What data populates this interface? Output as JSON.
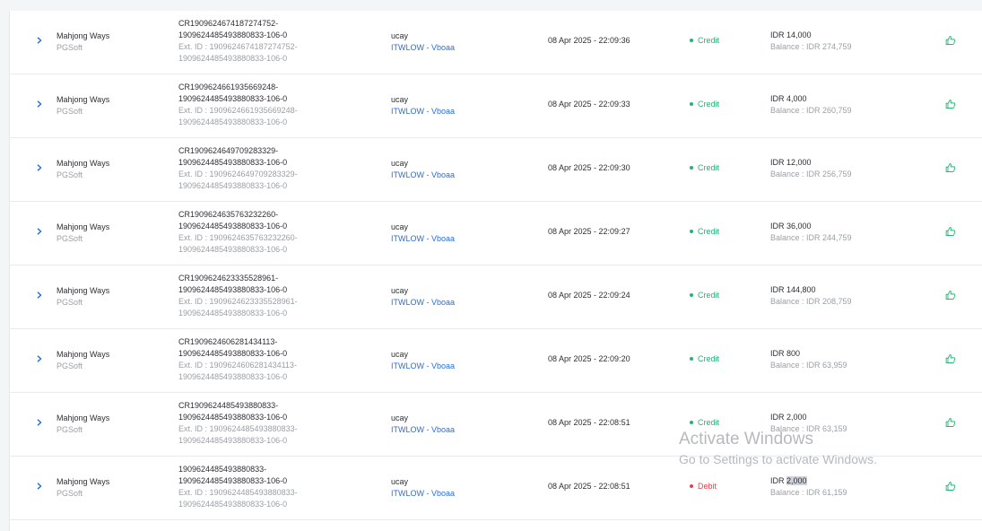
{
  "rows": [
    {
      "game": "Mahjong Ways",
      "provider": "PGSoft",
      "txn_line1": "CR1909624674187274752-",
      "txn_line2": "1909624485493880833-106-0",
      "ext_line1": "Ext. ID : 1909624674187274752-",
      "ext_line2": "1909624485493880833-106-0",
      "user": "ucay",
      "agent": "ITWLOW - Vboaa",
      "datetime": "08 Apr 2025 - 22:09:36",
      "type": "Credit",
      "amount_prefix": "IDR ",
      "amount_value": "14,000",
      "balance": "Balance : IDR 274,759"
    },
    {
      "game": "Mahjong Ways",
      "provider": "PGSoft",
      "txn_line1": "CR1909624661935669248-",
      "txn_line2": "1909624485493880833-106-0",
      "ext_line1": "Ext. ID : 1909624661935669248-",
      "ext_line2": "1909624485493880833-106-0",
      "user": "ucay",
      "agent": "ITWLOW - Vboaa",
      "datetime": "08 Apr 2025 - 22:09:33",
      "type": "Credit",
      "amount_prefix": "IDR ",
      "amount_value": "4,000",
      "balance": "Balance : IDR 260,759"
    },
    {
      "game": "Mahjong Ways",
      "provider": "PGSoft",
      "txn_line1": "CR1909624649709283329-",
      "txn_line2": "1909624485493880833-106-0",
      "ext_line1": "Ext. ID : 1909624649709283329-",
      "ext_line2": "1909624485493880833-106-0",
      "user": "ucay",
      "agent": "ITWLOW - Vboaa",
      "datetime": "08 Apr 2025 - 22:09:30",
      "type": "Credit",
      "amount_prefix": "IDR ",
      "amount_value": "12,000",
      "balance": "Balance : IDR 256,759"
    },
    {
      "game": "Mahjong Ways",
      "provider": "PGSoft",
      "txn_line1": "CR1909624635763232260-",
      "txn_line2": "1909624485493880833-106-0",
      "ext_line1": "Ext. ID : 1909624635763232260-",
      "ext_line2": "1909624485493880833-106-0",
      "user": "ucay",
      "agent": "ITWLOW - Vboaa",
      "datetime": "08 Apr 2025 - 22:09:27",
      "type": "Credit",
      "amount_prefix": "IDR ",
      "amount_value": "36,000",
      "balance": "Balance : IDR 244,759"
    },
    {
      "game": "Mahjong Ways",
      "provider": "PGSoft",
      "txn_line1": "CR1909624623335528961-",
      "txn_line2": "1909624485493880833-106-0",
      "ext_line1": "Ext. ID : 1909624623335528961-",
      "ext_line2": "1909624485493880833-106-0",
      "user": "ucay",
      "agent": "ITWLOW - Vboaa",
      "datetime": "08 Apr 2025 - 22:09:24",
      "type": "Credit",
      "amount_prefix": "IDR ",
      "amount_value": "144,800",
      "balance": "Balance : IDR 208,759"
    },
    {
      "game": "Mahjong Ways",
      "provider": "PGSoft",
      "txn_line1": "CR1909624606281434113-",
      "txn_line2": "1909624485493880833-106-0",
      "ext_line1": "Ext. ID : 1909624606281434113-",
      "ext_line2": "1909624485493880833-106-0",
      "user": "ucay",
      "agent": "ITWLOW - Vboaa",
      "datetime": "08 Apr 2025 - 22:09:20",
      "type": "Credit",
      "amount_prefix": "IDR ",
      "amount_value": "800",
      "balance": "Balance : IDR 63,959"
    },
    {
      "game": "Mahjong Ways",
      "provider": "PGSoft",
      "txn_line1": "CR1909624485493880833-",
      "txn_line2": "1909624485493880833-106-0",
      "ext_line1": "Ext. ID : 1909624485493880833-",
      "ext_line2": "1909624485493880833-106-0",
      "user": "ucay",
      "agent": "ITWLOW - Vboaa",
      "datetime": "08 Apr 2025 - 22:08:51",
      "type": "Credit",
      "amount_prefix": "IDR ",
      "amount_value": "2,000",
      "balance": "Balance : IDR 63,159"
    },
    {
      "game": "Mahjong Ways",
      "provider": "PGSoft",
      "txn_line1": "1909624485493880833-",
      "txn_line2": "1909624485493880833-106-0",
      "ext_line1": "Ext. ID : 1909624485493880833-",
      "ext_line2": "1909624485493880833-106-0",
      "user": "ucay",
      "agent": "ITWLOW - Vboaa",
      "datetime": "08 Apr 2025 - 22:08:51",
      "type": "Debit",
      "amount_prefix": "IDR ",
      "amount_value": "2,000",
      "amount_selected": true,
      "balance": "Balance : IDR 61,159"
    }
  ],
  "watermark": {
    "line1": "Activate Windows",
    "line2": "Go to Settings to activate Windows."
  },
  "colors": {
    "credit": "#22b573",
    "debit": "#e8404a",
    "link": "#2a6fd6"
  },
  "icons": {
    "expand": "chevron-right-icon",
    "action": "thumbs-up-icon"
  }
}
